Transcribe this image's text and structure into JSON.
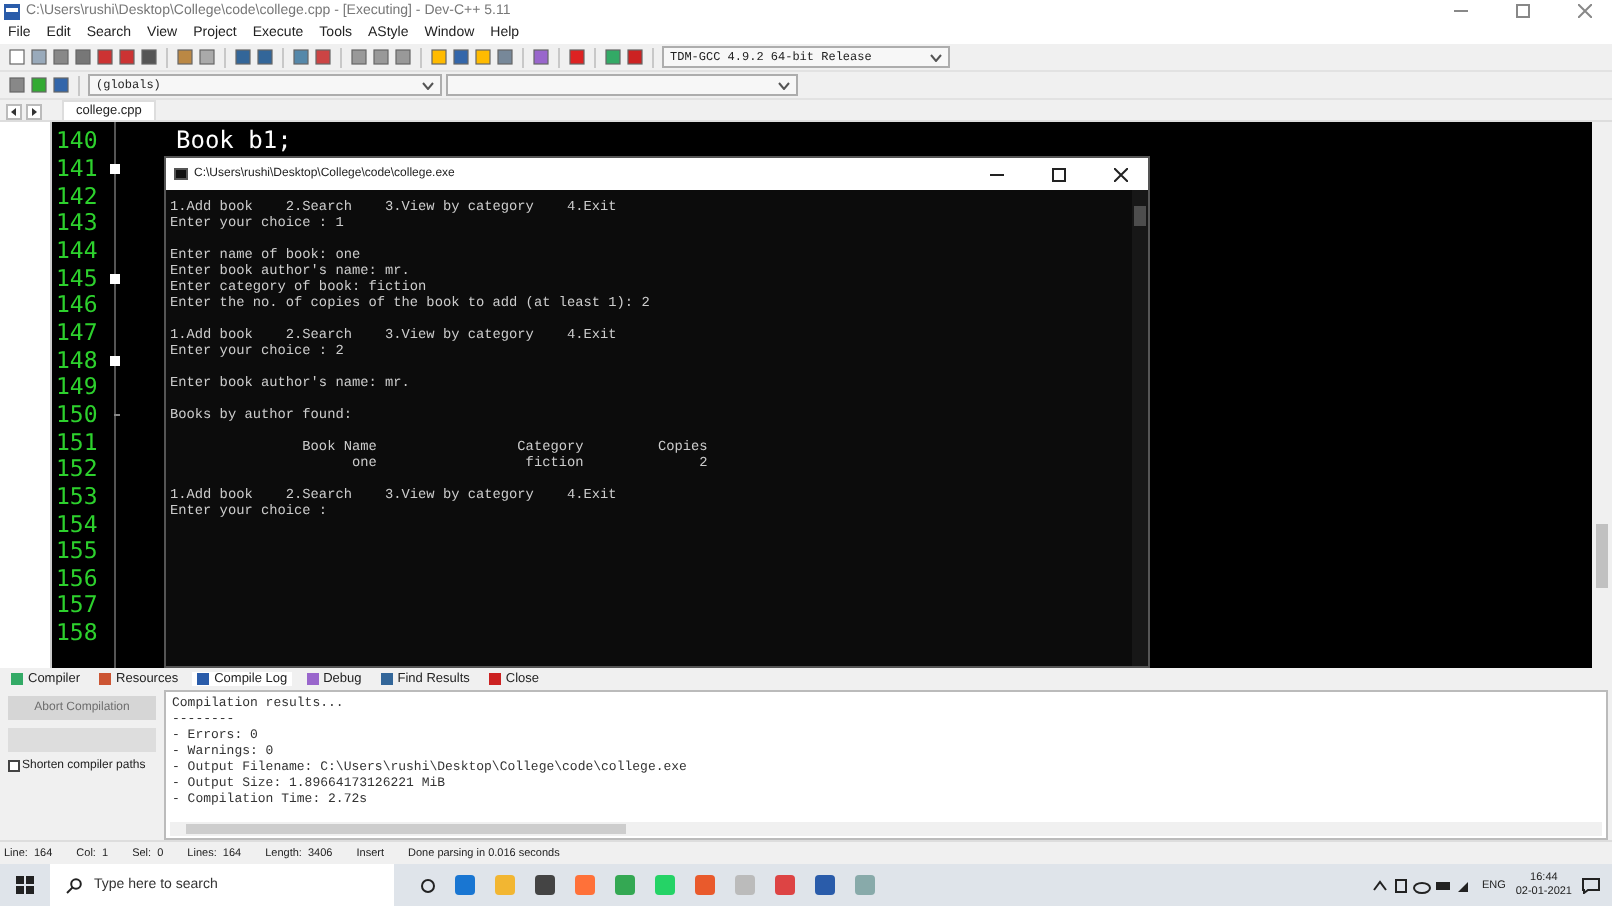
{
  "window": {
    "title": "C:\\Users\\rushi\\Desktop\\College\\code\\college.cpp - [Executing] - Dev-C++ 5.11"
  },
  "menu": [
    "File",
    "Edit",
    "Search",
    "View",
    "Project",
    "Execute",
    "Tools",
    "AStyle",
    "Window",
    "Help"
  ],
  "compiler_select": {
    "value": "TDM-GCC 4.9.2 64-bit Release"
  },
  "scope_select": {
    "value": "(globals)"
  },
  "file_tabs": [
    {
      "label": "college.cpp",
      "selected": true
    }
  ],
  "editor": {
    "lines": [
      {
        "number": "140",
        "kind": "plain",
        "code": "Book b1;"
      },
      {
        "number": "141",
        "kind": "fold_start"
      },
      {
        "number": "142",
        "kind": "plain"
      },
      {
        "number": "143",
        "kind": "plain"
      },
      {
        "number": "144",
        "kind": "plain"
      },
      {
        "number": "145",
        "kind": "fold_start"
      },
      {
        "number": "146",
        "kind": "plain"
      },
      {
        "number": "147",
        "kind": "plain"
      },
      {
        "number": "148",
        "kind": "fold_start"
      },
      {
        "number": "149",
        "kind": "plain"
      },
      {
        "number": "150",
        "kind": "fold_end"
      },
      {
        "number": "151",
        "kind": "plain"
      },
      {
        "number": "152",
        "kind": "plain"
      },
      {
        "number": "153",
        "kind": "plain"
      },
      {
        "number": "154",
        "kind": "plain"
      },
      {
        "number": "155",
        "kind": "plain"
      },
      {
        "number": "156",
        "kind": "plain"
      },
      {
        "number": "157",
        "kind": "plain"
      },
      {
        "number": "158",
        "kind": "plain"
      }
    ]
  },
  "console": {
    "title": "C:\\Users\\rushi\\Desktop\\College\\code\\college.exe",
    "blocks": [
      [
        "1.Add book    2.Search    3.View by category    4.Exit",
        "Enter your choice : 1"
      ],
      [
        "Enter name of book: one",
        "Enter book author's name: mr.",
        "Enter category of book: fiction",
        "Enter the no. of copies of the book to add (at least 1): 2"
      ],
      [
        "1.Add book    2.Search    3.View by category    4.Exit",
        "Enter your choice : 2"
      ],
      [
        "Enter book author's name: mr."
      ],
      [
        "Books by author found:"
      ],
      [
        "                Book Name                 Category         Copies",
        "                      one                  fiction              2"
      ],
      [
        "1.Add book    2.Search    3.View by category    4.Exit",
        "Enter your choice :"
      ]
    ]
  },
  "bottom_tabs": [
    {
      "label": "Compiler",
      "selected": false
    },
    {
      "label": "Resources",
      "selected": false
    },
    {
      "label": "Compile Log",
      "selected": true
    },
    {
      "label": "Debug",
      "selected": false
    },
    {
      "label": "Find Results",
      "selected": false
    },
    {
      "label": "Close",
      "selected": false
    }
  ],
  "abort_button": {
    "label": "Abort Compilation",
    "disabled": true
  },
  "shorten_paths": {
    "label": "Shorten compiler paths",
    "checked": false
  },
  "log": [
    "Compilation results...",
    "--------",
    "- Errors: 0",
    "- Warnings: 0",
    "- Output Filename: C:\\Users\\rushi\\Desktop\\College\\code\\college.exe",
    "- Output Size: 1.89664173126221 MiB",
    "- Compilation Time: 2.72s"
  ],
  "status_bar": {
    "fields": [
      {
        "label": "Line:",
        "value": "164"
      },
      {
        "label": "Col:",
        "value": "1"
      },
      {
        "label": "Sel:",
        "value": "0"
      },
      {
        "label": "Lines:",
        "value": "164"
      },
      {
        "label": "Length:",
        "value": "3406"
      }
    ],
    "mode": "Insert",
    "message": "Done parsing in 0.016 seconds"
  },
  "taskbar": {
    "search_placeholder": "Type here to search",
    "language": "ENG",
    "time": "16:44",
    "date": "02-01-2021"
  }
}
